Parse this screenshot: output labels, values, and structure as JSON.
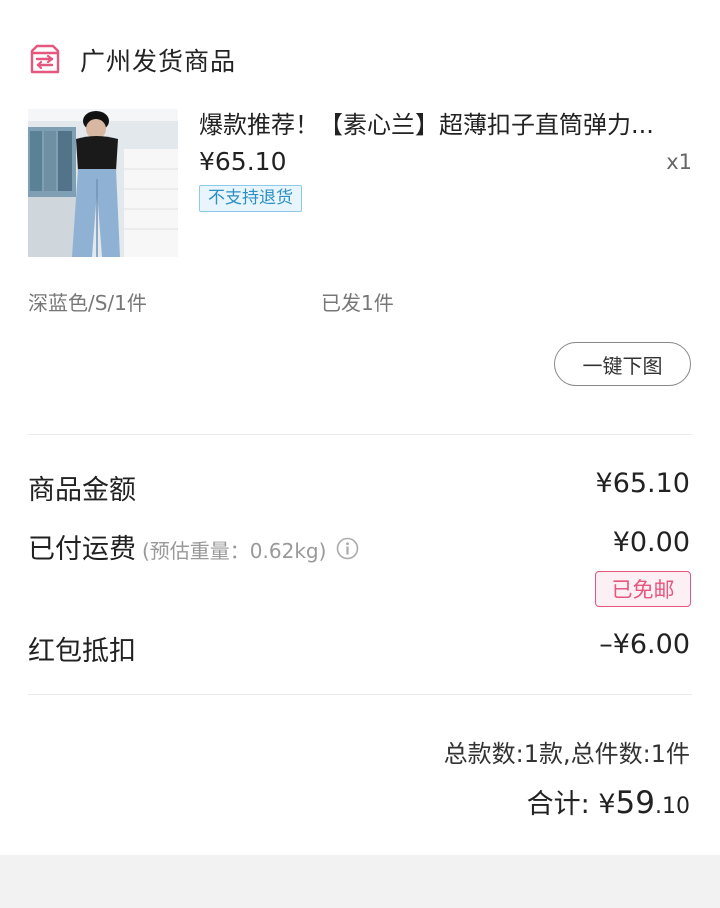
{
  "section": {
    "title": "广州发货商品",
    "icon": "store-delivery-icon"
  },
  "product": {
    "image_icon": "product-photo",
    "title": "爆款推荐！【素心兰】超薄扣子直筒弹力...",
    "price": "¥65.10",
    "quantity": "x1",
    "tag": "不支持退货",
    "variant": "深蓝色/S/1件",
    "shipped_status": "已发1件",
    "download_button": "一键下图"
  },
  "costs": {
    "goods_amount_label": "商品金额",
    "goods_amount_value": "¥65.10",
    "shipping_label": "已付运费",
    "shipping_weight": "(预估重量：0.62kg)",
    "shipping_value": "¥0.00",
    "free_shipping_badge": "已免邮",
    "coupon_label": "红包抵扣",
    "coupon_value": "–¥6.00"
  },
  "summary": {
    "count_text": "总款数:1款,总件数:1件",
    "total_label": "合计: ",
    "total_currency": "¥",
    "total_integer": "59",
    "total_decimal": ".10"
  },
  "colors": {
    "accent_pink": "#e5577e",
    "tag_blue": "#2c8fc6"
  }
}
